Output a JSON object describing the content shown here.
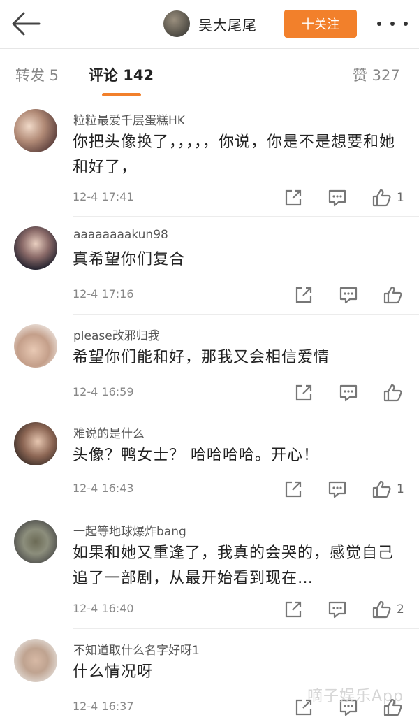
{
  "header": {
    "back_icon": "back-arrow-icon",
    "user_name": "吴大尾尾",
    "follow_label": "十关注",
    "more_icon": "more-dots-icon"
  },
  "tabs": {
    "repost": "转发 5",
    "comments": "评论 142",
    "likes": "赞 327"
  },
  "colors": {
    "accent": "#f2802b"
  },
  "comments": [
    {
      "name": "粒粒最爱千层蛋糕HK",
      "text": "你把头像换了，，，，，你说，你是不是想要和她和好了，",
      "time": "12-4 17:41",
      "likes": "1"
    },
    {
      "name": "aaaaaaaakun98",
      "text": "真希望你们复合",
      "time": "12-4 17:16",
      "likes": ""
    },
    {
      "name": "please改邪归我",
      "text": "希望你们能和好，那我又会相信爱情",
      "time": "12-4 16:59",
      "likes": ""
    },
    {
      "name": "难说的是什么",
      "text": "头像？鸭女士？ 哈哈哈哈。开心！",
      "time": "12-4 16:43",
      "likes": "1"
    },
    {
      "name": "一起等地球爆炸bang",
      "text": "如果和她又重逢了，我真的会哭的，感觉自己追了一部剧，从最开始看到现在…",
      "time": "12-4 16:40",
      "likes": "2"
    },
    {
      "name": "不知道取什么名字好呀1",
      "text": "什么情况呀",
      "time": "12-4 16:37",
      "likes": ""
    }
  ],
  "watermark": "嘀子娱乐App"
}
